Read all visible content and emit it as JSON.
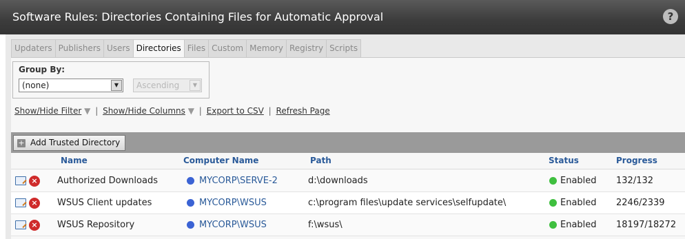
{
  "window": {
    "title": "Software Rules: Directories Containing Files for Automatic Approval",
    "help_icon": "?"
  },
  "tabs": [
    {
      "label": "Updaters",
      "active": false
    },
    {
      "label": "Publishers",
      "active": false
    },
    {
      "label": "Users",
      "active": false
    },
    {
      "label": "Directories",
      "active": true
    },
    {
      "label": "Files",
      "active": false
    },
    {
      "label": "Custom",
      "active": false
    },
    {
      "label": "Memory",
      "active": false
    },
    {
      "label": "Registry",
      "active": false
    },
    {
      "label": "Scripts",
      "active": false
    }
  ],
  "group_by": {
    "label": "Group By:",
    "value": "(none)",
    "order_value": "Ascending",
    "order_disabled": true
  },
  "links": {
    "show_hide_filter": "Show/Hide Filter",
    "show_hide_columns": "Show/Hide Columns",
    "export_csv": "Export to CSV",
    "refresh": "Refresh Page",
    "dropdown_glyph": "▼",
    "separator": "|"
  },
  "toolbar": {
    "add_label": "Add Trusted Directory",
    "add_icon": "plus-icon"
  },
  "columns": [
    "Name",
    "Computer Name",
    "Path",
    "Status",
    "Progress"
  ],
  "rows": [
    {
      "name": "Authorized Downloads",
      "computer": "MYCORP\\SERVE-2",
      "path": "d:\\downloads",
      "status": "Enabled",
      "progress": "132/132"
    },
    {
      "name": "WSUS Client updates",
      "computer": "MYCORP\\WSUS",
      "path": "c:\\program files\\update services\\selfupdate\\",
      "status": "Enabled",
      "progress": "2246/2339"
    },
    {
      "name": "WSUS Repository",
      "computer": "MYCORP\\WSUS",
      "path": "f:\\wsus\\",
      "status": "Enabled",
      "progress": "18197/18272"
    }
  ],
  "colors": {
    "computer_dot": "#3b63d4",
    "status_dot": "#3fbf3f",
    "header_text": "#2a5a99",
    "titlebar": "#3c3c3c"
  }
}
